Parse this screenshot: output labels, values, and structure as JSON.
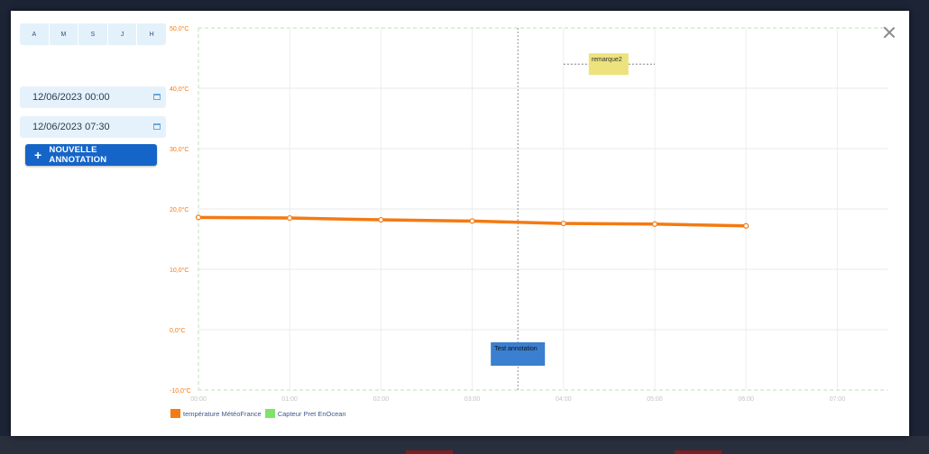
{
  "periods": [
    "A",
    "M",
    "S",
    "J",
    "H"
  ],
  "start_date": "12/06/2023 00:00",
  "end_date": "12/06/2023 07:30",
  "add_annotation_label": "NOUVELLE ANNOTATION",
  "colors": {
    "accent": "#1565c8",
    "series_temperature": "#f47a12",
    "series_sensor": "#7de36a",
    "axis_label": "#f47a12"
  },
  "chart_data": {
    "type": "line",
    "y_ticks": [
      "50,0°C",
      "40,0°C",
      "30,0°C",
      "20,0°C",
      "10,0°C",
      "0,0°C",
      "-10,0°C"
    ],
    "x_ticks": [
      "00:00",
      "01:00",
      "02:00",
      "03:00",
      "04:00",
      "05:00",
      "06:00",
      "07:00"
    ],
    "ylim": [
      -10,
      50
    ],
    "xlim_hours": [
      0,
      7.5
    ],
    "grid": true,
    "legend_position": "bottom-left",
    "series": [
      {
        "name": "température MétéoFrance",
        "color": "#f47a12",
        "x": [
          "00:00",
          "01:00",
          "02:00",
          "03:00",
          "04:00",
          "05:00",
          "06:00"
        ],
        "values": [
          18.6,
          18.5,
          18.2,
          18.0,
          17.6,
          17.5,
          17.2
        ]
      },
      {
        "name": "Capteur Pret EnOcean",
        "color": "#7de36a",
        "x": [],
        "values": []
      }
    ],
    "annotations": [
      {
        "label": "remarque2",
        "time": "04:00",
        "time_end": "05:00",
        "value": 44,
        "color": "#ece27e"
      },
      {
        "label": "Test annotation",
        "time": "03:30",
        "color": "#3a7fd0"
      }
    ]
  }
}
